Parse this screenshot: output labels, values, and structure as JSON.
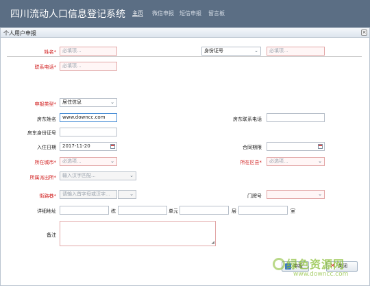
{
  "app": {
    "title": "四川流动人口信息登记系统"
  },
  "nav": {
    "items": [
      "主页",
      "微信申报",
      "短信申报",
      "留言板"
    ]
  },
  "panel": {
    "title": "个人用户申报",
    "close": "×"
  },
  "form": {
    "name_label": "姓名*",
    "name_ph": "必填项...",
    "id_type": "身份证号",
    "id_ph": "必填项...",
    "phone_label": "联系电话*",
    "phone_ph": "必填项...",
    "report_type_label": "申报类型*",
    "report_type_value": "居住信息",
    "landlord_name_label": "房东姓名",
    "landlord_name_value": "www.downcc.com",
    "landlord_phone_label": "房东联系电话",
    "landlord_id_label": "房东身份证号",
    "checkin_label": "入住日期",
    "checkin_value": "2017-11-20",
    "lease_label": "合同期限",
    "city_label": "所在城市*",
    "city_ph": "必选项...",
    "district_label": "所在区县*",
    "district_ph": "必选项...",
    "police_label": "所属派出所*",
    "police_ph": "输入汉字匹配...",
    "street_label": "街路巷*",
    "street_ph": "请输入首字母或汉字...",
    "door_label": "门牌号",
    "address_label": "详细地址",
    "building": "栋",
    "unit": "单元",
    "floor": "层",
    "room": "室",
    "remark_label": "备注"
  },
  "buttons": {
    "save": "申报",
    "cancel": "关闭"
  },
  "watermark": {
    "text": "绿色资源网",
    "url": "www.downcc.com"
  },
  "colors": {
    "topbar": "#5b6e84",
    "required": "#d01a1a",
    "watermark": "#8cbf3a"
  }
}
